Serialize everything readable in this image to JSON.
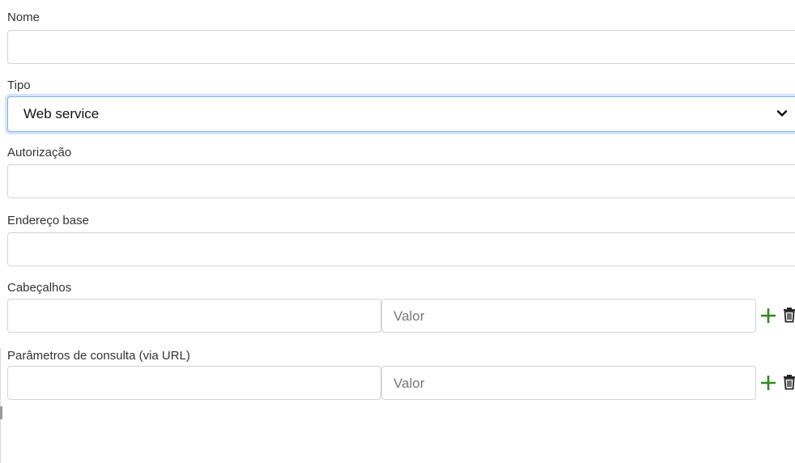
{
  "form": {
    "nome": {
      "label": "Nome",
      "value": ""
    },
    "tipo": {
      "label": "Tipo",
      "selected": "Web service"
    },
    "autorizacao": {
      "label": "Autorização",
      "value": ""
    },
    "endereco_base": {
      "label": "Endereço base",
      "value": ""
    },
    "cabecalhos": {
      "label": "Cabeçalhos",
      "key_value": "",
      "value_placeholder": "Valor",
      "add_icon": "plus-icon",
      "delete_icon": "trash-icon"
    },
    "parametros": {
      "label": "Parâmetros de consulta (via URL)",
      "key_value": "",
      "value_placeholder": "Valor",
      "add_icon": "plus-icon",
      "delete_icon": "trash-icon"
    }
  },
  "colors": {
    "accent_focus": "#80b3f0",
    "add_green": "#2e8b1e",
    "border": "#d0d4d9"
  }
}
